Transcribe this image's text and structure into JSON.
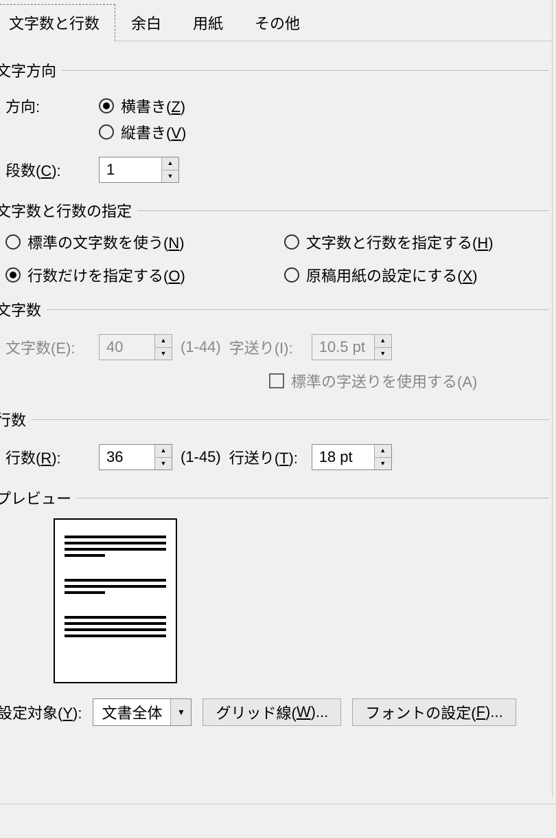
{
  "tabs": {
    "t1": "文字数と行数",
    "t2": "余白",
    "t3": "用紙",
    "t4": "その他"
  },
  "direction": {
    "group": "文字方向",
    "label": "方向:",
    "horizontal": "横書き(",
    "horizontal_key": "Z",
    "horizontal_tail": ")",
    "vertical": "縦書き(",
    "vertical_key": "V",
    "vertical_tail": ")",
    "columns_label": "段数(",
    "columns_key": "C",
    "columns_tail": "):",
    "columns_value": "1"
  },
  "spec": {
    "group": "文字数と行数の指定",
    "opt1": "標準の文字数を使う(",
    "opt1_key": "N",
    "opt1_tail": ")",
    "opt2": "文字数と行数を指定する(",
    "opt2_key": "H",
    "opt2_tail": ")",
    "opt3": "行数だけを指定する(",
    "opt3_key": "O",
    "opt3_tail": ")",
    "opt4": "原稿用紙の設定にする(",
    "opt4_key": "X",
    "opt4_tail": ")"
  },
  "chars": {
    "group": "文字数",
    "label": "文字数(E):",
    "value": "40",
    "range": "(1-44)",
    "pitch_label": "字送り(I):",
    "pitch_value": "10.5 pt",
    "std_label": "標準の字送りを使用する(A)"
  },
  "lines": {
    "group": "行数",
    "label": "行数(",
    "key": "R",
    "tail": "):",
    "value": "36",
    "range": "(1-45)",
    "pitch_label": "行送り(",
    "pitch_key": "T",
    "pitch_tail": "):",
    "pitch_value": "18 pt"
  },
  "preview": {
    "group": "プレビュー"
  },
  "bottom": {
    "apply_label": "設定対象(",
    "apply_key": "Y",
    "apply_tail": "):",
    "apply_value": "文書全体",
    "grid_btn": "グリッド線(",
    "grid_key": "W",
    "grid_tail": ")...",
    "font_btn": "フォントの設定(",
    "font_key": "F",
    "font_tail": ")..."
  }
}
